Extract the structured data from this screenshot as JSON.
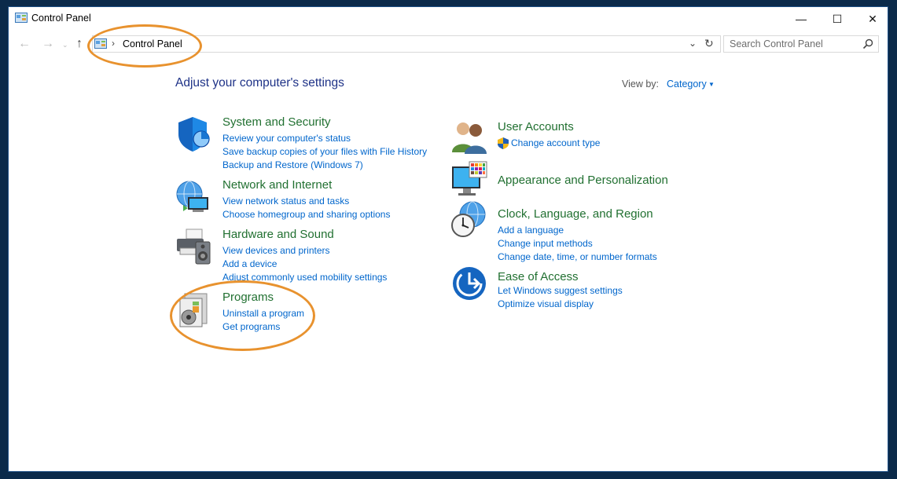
{
  "window": {
    "title": "Control Panel"
  },
  "window_controls": {
    "minimize": "—",
    "maximize": "☐",
    "close": "✕"
  },
  "nav": {
    "back": "←",
    "forward": "→",
    "recent": "⌄",
    "up": "↑"
  },
  "address": {
    "separator": "›",
    "location": "Control Panel",
    "dropdown": "⌄",
    "refresh": "↻"
  },
  "search": {
    "placeholder": "Search Control Panel"
  },
  "main": {
    "heading": "Adjust your computer's settings",
    "view_by_label": "View by:",
    "view_by_value": "Category",
    "view_by_caret": "▼"
  },
  "categories": [
    {
      "title": "System and Security",
      "icon": "shield-icon",
      "links": [
        "Review your computer's status",
        "Save backup copies of your files with File History",
        "Backup and Restore (Windows 7)"
      ]
    },
    {
      "title": "Network and Internet",
      "icon": "network-globe-icon",
      "links": [
        "View network status and tasks",
        "Choose homegroup and sharing options"
      ]
    },
    {
      "title": "Hardware and Sound",
      "icon": "printer-speaker-icon",
      "links": [
        "View devices and printers",
        "Add a device",
        "Adjust commonly used mobility settings"
      ]
    },
    {
      "title": "Programs",
      "icon": "programs-disc-icon",
      "links": [
        "Uninstall a program",
        "Get programs"
      ]
    },
    {
      "title": "User Accounts",
      "icon": "users-icon",
      "links": [
        "Change account type"
      ]
    },
    {
      "title": "Appearance and Personalization",
      "icon": "monitor-palette-icon",
      "links": []
    },
    {
      "title": "Clock, Language, and Region",
      "icon": "clock-globe-icon",
      "links": [
        "Add a language",
        "Change input methods",
        "Change date, time, or number formats"
      ]
    },
    {
      "title": "Ease of Access",
      "icon": "ease-of-access-icon",
      "links": [
        "Let Windows suggest settings",
        "Optimize visual display"
      ]
    }
  ],
  "colors": {
    "category_title": "#217031",
    "link": "#0066cc",
    "heading": "#1e3287",
    "highlight_ring": "#e8922e"
  }
}
